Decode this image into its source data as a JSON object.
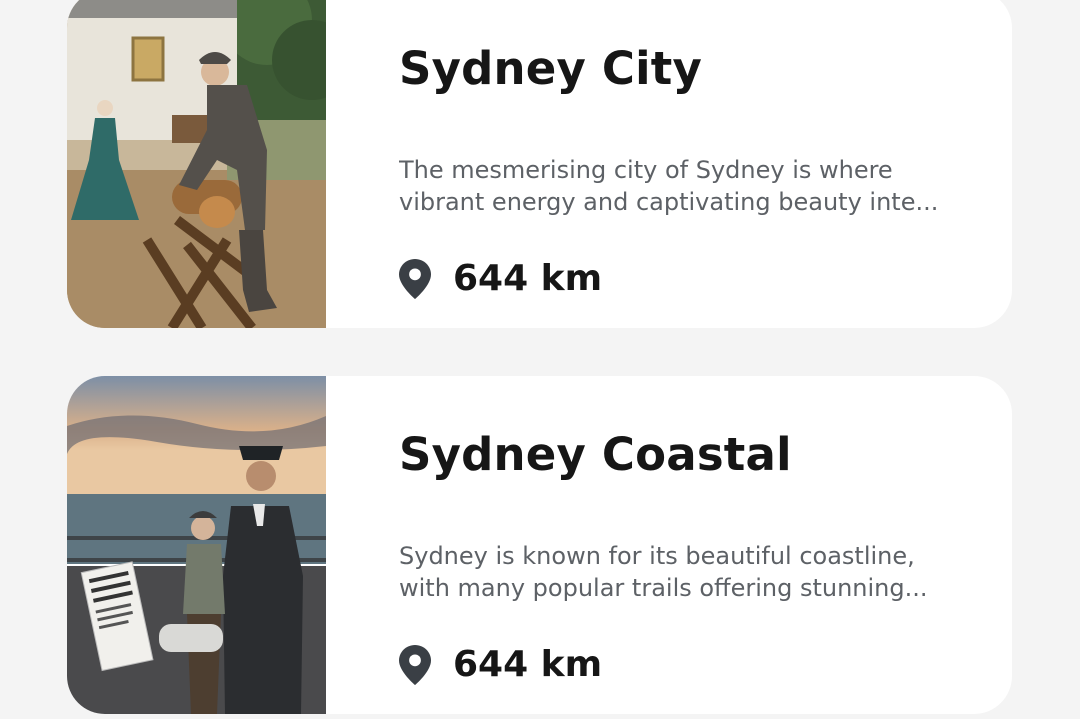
{
  "places": [
    {
      "title": "Sydney City",
      "description_line1": "The mesmerising city of Sydney is where",
      "description_line2": "vibrant energy and captivating beauty inte...",
      "distance": "644 km",
      "icon": "location-pin-icon"
    },
    {
      "title": "Sydney Coastal",
      "description_line1": "Sydney is known for its beautiful coastline,",
      "description_line2": "with many popular trails offering stunning...",
      "distance": "644 km",
      "icon": "location-pin-icon"
    }
  ],
  "colors": {
    "background": "#f4f4f4",
    "card": "#ffffff",
    "title": "#161616",
    "description": "#5d6166",
    "pin": "#3a3f45"
  }
}
